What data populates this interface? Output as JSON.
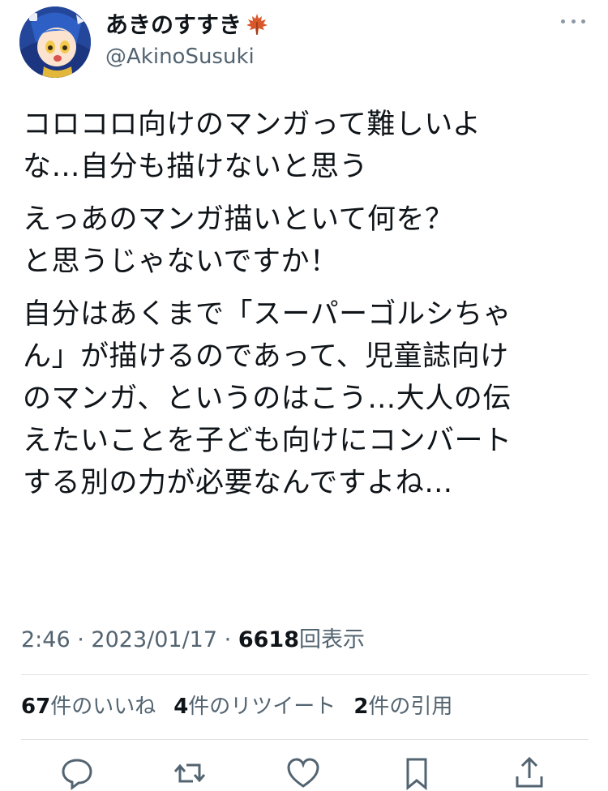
{
  "author": {
    "display_name": "あきのすすき",
    "name_emoji": "maple-leaf-icon",
    "handle": "@AkinoSusuki"
  },
  "tweet": {
    "paragraphs": [
      [
        "コロコロ向けのマンガって難しいよ",
        "な…自分も描けないと思う"
      ],
      [
        "えっあのマンガ描いといて何を？",
        "と思うじゃないですか！"
      ],
      [
        "自分はあくまで「スーパーゴルシちゃ",
        "ん」が描けるのであって、児童誌向け",
        "のマンガ、というのはこう…大人の伝",
        "えたいことを子ども向けにコンバート",
        "する別の力が必要なんですよね…"
      ]
    ]
  },
  "meta": {
    "time": "2:46",
    "separator": "·",
    "date": "2023/01/17",
    "views_count": "6618",
    "views_label": "回表示"
  },
  "stats": {
    "likes_count": "67",
    "likes_label": "件のいいね",
    "retweets_count": "4",
    "retweets_label": "件のリツイート",
    "quotes_count": "2",
    "quotes_label": "件の引用"
  },
  "actions": [
    "reply-icon",
    "retweet-icon",
    "like-icon",
    "bookmark-icon",
    "share-icon"
  ],
  "colors": {
    "text_primary": "#0f1419",
    "text_secondary": "#536471",
    "divider": "#dfe3e6",
    "icon": "#536471"
  }
}
